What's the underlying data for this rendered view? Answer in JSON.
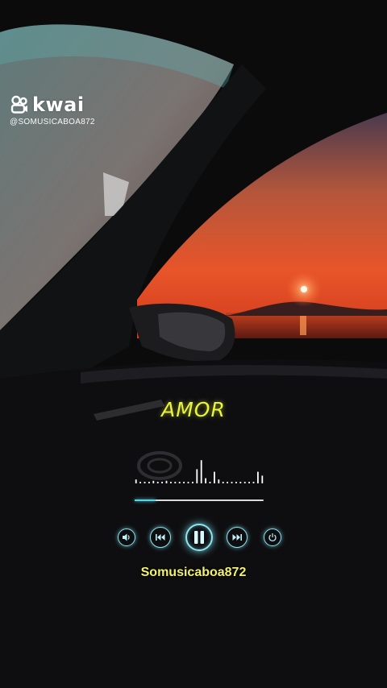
{
  "watermark": {
    "logo_text": "kwai",
    "handle": "@SOMUSICABOA872"
  },
  "player": {
    "song_title": "AMOR",
    "channel_name": "Somusicaboa872",
    "progress_fraction": 0.16,
    "accent_color": "#8fe6f0",
    "title_color": "#e8f53a",
    "equalizer_levels": [
      0.15,
      0.05,
      0.05,
      0.05,
      0.1,
      0.05,
      0.05,
      0.1,
      0.05,
      0.05,
      0.05,
      0.05,
      0.05,
      0.05,
      0.55,
      0.9,
      0.2,
      0.05,
      0.45,
      0.15,
      0.05,
      0.05,
      0.05,
      0.05,
      0.05,
      0.05,
      0.05,
      0.05,
      0.45,
      0.3
    ],
    "controls": [
      {
        "name": "volume-button",
        "icon": "speaker-icon"
      },
      {
        "name": "previous-button",
        "icon": "skip-previous-icon"
      },
      {
        "name": "pause-button",
        "icon": "pause-icon"
      },
      {
        "name": "next-button",
        "icon": "skip-next-icon"
      },
      {
        "name": "power-button",
        "icon": "power-icon"
      }
    ]
  }
}
